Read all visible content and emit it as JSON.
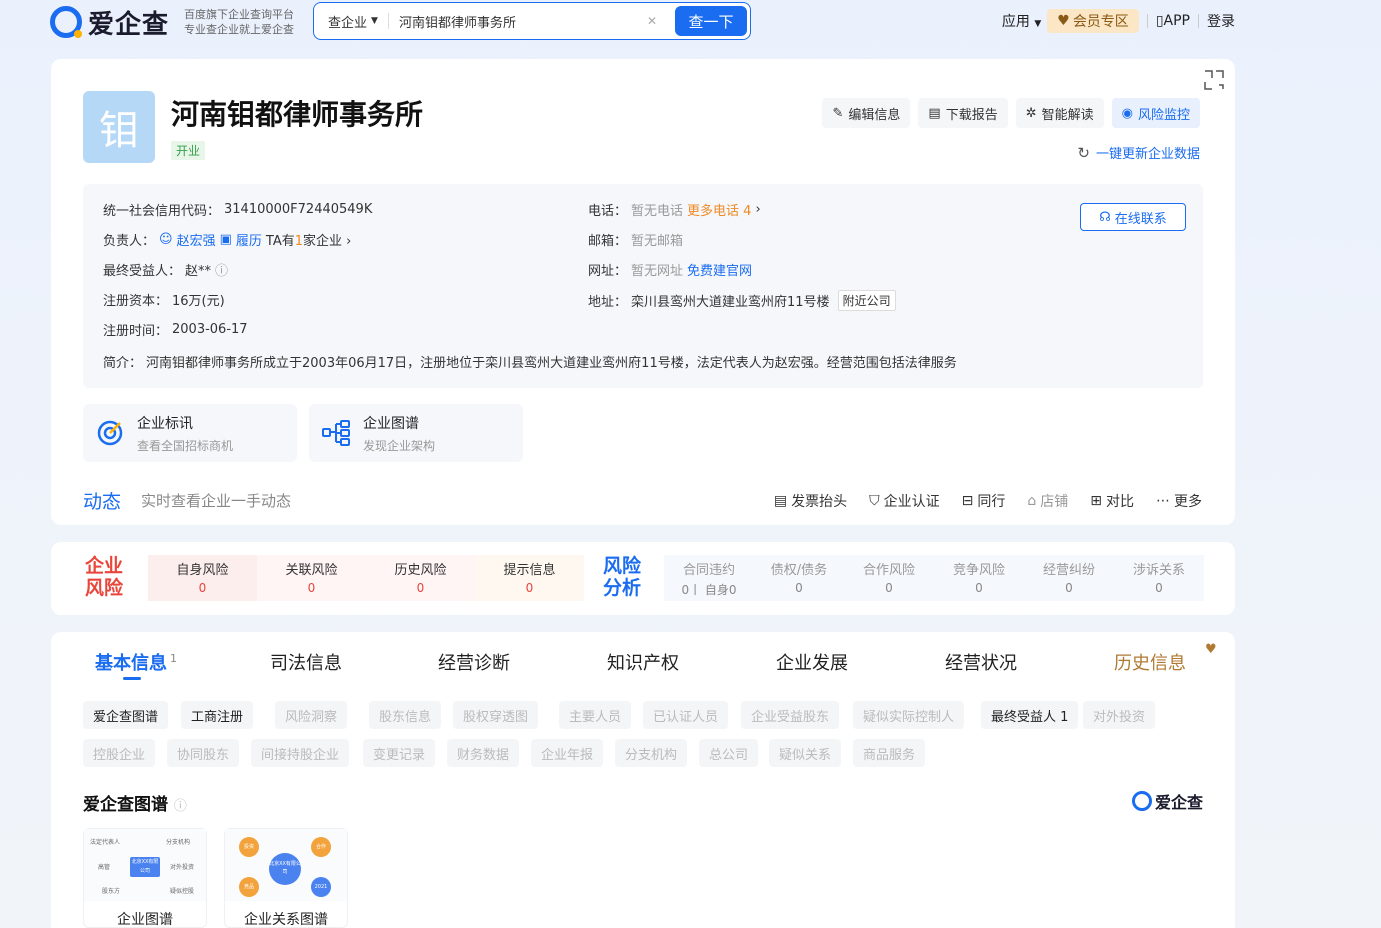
{
  "header": {
    "logo_text": "爱企查",
    "slogan_1": "百度旗下企业查询平台",
    "slogan_2": "专业查企业就上爱企查",
    "search_type": "查企业",
    "search_value": "河南钼都律师事务所",
    "search_button": "查一下",
    "nav": {
      "apps": "应用",
      "vip": "会员专区",
      "app": "APP",
      "login": "登录"
    }
  },
  "company": {
    "avatar_char": "钼",
    "name": "河南钼都律师事务所",
    "status": "开业",
    "actions": [
      "编辑信息",
      "下载报告",
      "智能解读",
      "风险监控"
    ],
    "refresh": "一键更新企业数据",
    "info": {
      "credit_label": "统一社会信用代码：",
      "credit_value": "31410000F72440549K",
      "leader_label": "负责人：",
      "leader_name": "赵宏强",
      "resume": "履历",
      "ta_prefix": "TA有",
      "ta_count": "1",
      "ta_suffix": "家企业",
      "beneficiary_label": "最终受益人：",
      "beneficiary_value": "赵**",
      "capital_label": "注册资本：",
      "capital_value": "16万(元)",
      "date_label": "注册时间：",
      "date_value": "2003-06-17",
      "phone_label": "电话：",
      "phone_value": "暂无电话",
      "phone_more": "更多电话 4",
      "email_label": "邮箱：",
      "email_value": "暂无邮箱",
      "web_label": "网址：",
      "web_value": "暂无网址",
      "web_link": "免费建官网",
      "addr_label": "地址：",
      "addr_value": "栾川县鸾州大道建业鸾州府11号楼",
      "addr_tag": "附近公司",
      "intro_label": "简介：",
      "intro_value": "河南钼都律师事务所成立于2003年06月17日，注册地位于栾川县鸾州大道建业鸾州府11号楼，法定代表人为赵宏强。经营范围包括法律服务",
      "contact": "在线联系"
    },
    "tools": [
      {
        "title": "企业标讯",
        "sub": "查看全国招标商机"
      },
      {
        "title": "企业图谱",
        "sub": "发现企业架构"
      }
    ],
    "dynamic_title": "动态",
    "dynamic_sub": "实时查看企业一手动态",
    "links": [
      "发票抬头",
      "企业认证",
      "同行",
      "店铺",
      "对比",
      "更多"
    ]
  },
  "risk": {
    "label_1": "企业",
    "label_2": "风险",
    "items": [
      {
        "name": "自身风险",
        "count": "0"
      },
      {
        "name": "关联风险",
        "count": "0"
      },
      {
        "name": "历史风险",
        "count": "0"
      },
      {
        "name": "提示信息",
        "count": "0"
      }
    ],
    "analysis_1": "风险",
    "analysis_2": "分析",
    "analysis": [
      {
        "name": "合同违约",
        "count": "0丨 自身0"
      },
      {
        "name": "债权/债务",
        "count": "0"
      },
      {
        "name": "合作风险",
        "count": "0"
      },
      {
        "name": "竞争风险",
        "count": "0"
      },
      {
        "name": "经营纠纷",
        "count": "0"
      },
      {
        "name": "涉诉关系",
        "count": "0"
      }
    ]
  },
  "tabs": [
    {
      "label": "基本信息",
      "badge": "1"
    },
    {
      "label": "司法信息"
    },
    {
      "label": "经营诊断"
    },
    {
      "label": "知识产权"
    },
    {
      "label": "企业发展"
    },
    {
      "label": "经营状况"
    },
    {
      "label": "历史信息"
    }
  ],
  "chips_row1": [
    {
      "t": "爱企查图谱",
      "on": true
    },
    {
      "t": "工商注册",
      "on": true
    },
    {
      "t": "风险洞察"
    },
    {
      "t": "股东信息"
    },
    {
      "t": "股权穿透图"
    },
    {
      "t": "主要人员"
    },
    {
      "t": "已认证人员"
    },
    {
      "t": "企业受益股东"
    },
    {
      "t": "疑似实际控制人"
    },
    {
      "t": "最终受益人 1",
      "on": true
    },
    {
      "t": "对外投资"
    }
  ],
  "chips_row2": [
    {
      "t": "控股企业"
    },
    {
      "t": "协同股东"
    },
    {
      "t": "间接持股企业"
    },
    {
      "t": "变更记录"
    },
    {
      "t": "财务数据"
    },
    {
      "t": "企业年报"
    },
    {
      "t": "分支机构"
    },
    {
      "t": "总公司"
    },
    {
      "t": "疑似关系"
    },
    {
      "t": "商品服务"
    }
  ],
  "graph": {
    "title": "爱企查图谱",
    "brand": "爱企查",
    "cards": [
      "企业图谱",
      "企业关系图谱"
    ],
    "mini1": {
      "center": "北京XX有限公司",
      "nodes": [
        "法定代表人",
        "分支机构",
        "高管",
        "对外投资",
        "股东方",
        "疑似控股"
      ]
    },
    "mini2": {
      "center": "北京XX有限公司",
      "nodes": [
        "投资",
        "合作",
        "竞品",
        "2021"
      ]
    }
  },
  "colors": {
    "accent": "#1a6cf0",
    "risk_red": "#e8463a",
    "orange": "#f08a24"
  }
}
